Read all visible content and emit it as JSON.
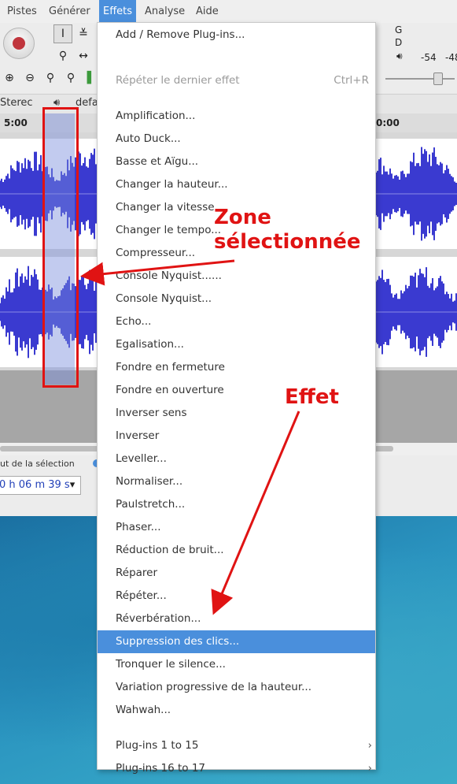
{
  "menubar": {
    "items": [
      "Pistes",
      "Générer",
      "Effets",
      "Analyse",
      "Aide"
    ],
    "active": "Effets"
  },
  "toolbar": {
    "meter_labels": {
      "g": "G",
      "d": "D",
      "db1": "-54",
      "db2": "-48"
    }
  },
  "track": {
    "name": "Sterec",
    "device": "defa"
  },
  "ruler": {
    "left_label": "5:00",
    "right_label": "0:00"
  },
  "bottom": {
    "selection_label": "ut de la sélection",
    "time_value": "0 h 06 m 39 s"
  },
  "menu": {
    "items": [
      {
        "label": "Add / Remove Plug-ins...",
        "shortcut": "",
        "submenu": false,
        "disabled": false,
        "highlighted": false
      },
      {
        "label": "Répéter le dernier effet",
        "shortcut": "Ctrl+R",
        "submenu": false,
        "disabled": true,
        "highlighted": false
      },
      {
        "label": "Amplification...",
        "shortcut": "",
        "submenu": false,
        "disabled": false,
        "highlighted": false
      },
      {
        "label": "Auto Duck...",
        "shortcut": "",
        "submenu": false,
        "disabled": false,
        "highlighted": false
      },
      {
        "label": "Basse et Aïgu...",
        "shortcut": "",
        "submenu": false,
        "disabled": false,
        "highlighted": false
      },
      {
        "label": "Changer la hauteur...",
        "shortcut": "",
        "submenu": false,
        "disabled": false,
        "highlighted": false
      },
      {
        "label": "Changer la vitesse...",
        "shortcut": "",
        "submenu": false,
        "disabled": false,
        "highlighted": false
      },
      {
        "label": "Changer le tempo...",
        "shortcut": "",
        "submenu": false,
        "disabled": false,
        "highlighted": false
      },
      {
        "label": "Compresseur...",
        "shortcut": "",
        "submenu": false,
        "disabled": false,
        "highlighted": false
      },
      {
        "label": "Console Nyquist......",
        "shortcut": "",
        "submenu": false,
        "disabled": false,
        "highlighted": false
      },
      {
        "label": "Console Nyquist...",
        "shortcut": "",
        "submenu": false,
        "disabled": false,
        "highlighted": false
      },
      {
        "label": "Echo...",
        "shortcut": "",
        "submenu": false,
        "disabled": false,
        "highlighted": false
      },
      {
        "label": "Egalisation...",
        "shortcut": "",
        "submenu": false,
        "disabled": false,
        "highlighted": false
      },
      {
        "label": "Fondre en fermeture",
        "shortcut": "",
        "submenu": false,
        "disabled": false,
        "highlighted": false
      },
      {
        "label": "Fondre en ouverture",
        "shortcut": "",
        "submenu": false,
        "disabled": false,
        "highlighted": false
      },
      {
        "label": "Inverser sens",
        "shortcut": "",
        "submenu": false,
        "disabled": false,
        "highlighted": false
      },
      {
        "label": "Inverser",
        "shortcut": "",
        "submenu": false,
        "disabled": false,
        "highlighted": false
      },
      {
        "label": "Leveller...",
        "shortcut": "",
        "submenu": false,
        "disabled": false,
        "highlighted": false
      },
      {
        "label": "Normaliser...",
        "shortcut": "",
        "submenu": false,
        "disabled": false,
        "highlighted": false
      },
      {
        "label": "Paulstretch...",
        "shortcut": "",
        "submenu": false,
        "disabled": false,
        "highlighted": false
      },
      {
        "label": "Phaser...",
        "shortcut": "",
        "submenu": false,
        "disabled": false,
        "highlighted": false
      },
      {
        "label": "Réduction de bruit...",
        "shortcut": "",
        "submenu": false,
        "disabled": false,
        "highlighted": false
      },
      {
        "label": "Réparer",
        "shortcut": "",
        "submenu": false,
        "disabled": false,
        "highlighted": false
      },
      {
        "label": "Répéter...",
        "shortcut": "",
        "submenu": false,
        "disabled": false,
        "highlighted": false
      },
      {
        "label": "Réverbération...",
        "shortcut": "",
        "submenu": false,
        "disabled": false,
        "highlighted": false
      },
      {
        "label": "Suppression des clics...",
        "shortcut": "",
        "submenu": false,
        "disabled": false,
        "highlighted": true
      },
      {
        "label": "Tronquer le silence...",
        "shortcut": "",
        "submenu": false,
        "disabled": false,
        "highlighted": false
      },
      {
        "label": "Variation progressive de la hauteur...",
        "shortcut": "",
        "submenu": false,
        "disabled": false,
        "highlighted": false
      },
      {
        "label": "Wahwah...",
        "shortcut": "",
        "submenu": false,
        "disabled": false,
        "highlighted": false
      },
      {
        "label": "Plug-ins 1 to 15",
        "shortcut": "",
        "submenu": true,
        "disabled": false,
        "highlighted": false
      },
      {
        "label": "Plug-ins 16 to 17",
        "shortcut": "",
        "submenu": true,
        "disabled": false,
        "highlighted": false
      }
    ]
  },
  "annotations": {
    "zone_line1": "Zone",
    "zone_line2": "sélectionnée",
    "effet": "Effet",
    "color": "#e01313"
  },
  "colors": {
    "highlight": "#4a8fdc",
    "waveform": "#3a3ad0"
  }
}
